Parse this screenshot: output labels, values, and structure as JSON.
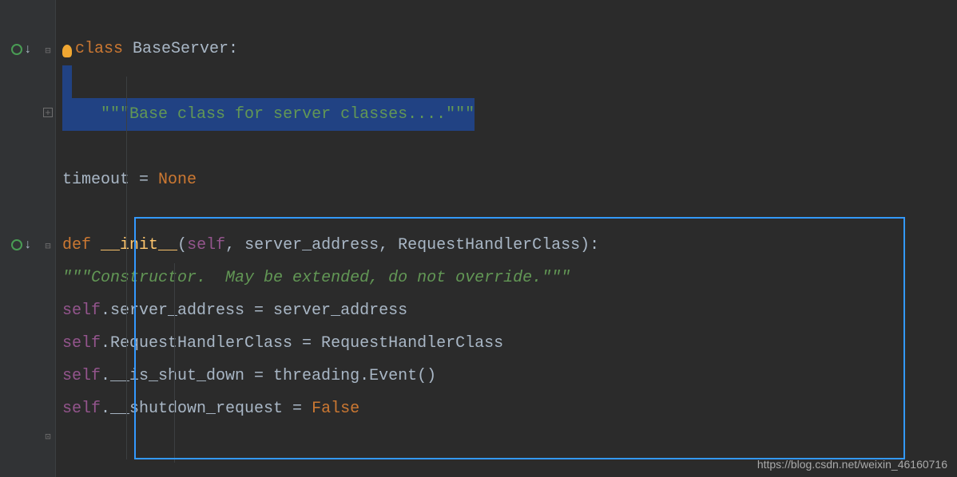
{
  "code": {
    "line1_kw": "class",
    "line1_name": " BaseServer:",
    "docstring1_open": "\"\"\"",
    "docstring1_body": "Base class for server classes....",
    "docstring1_close": "\"\"\"",
    "timeout_name": "timeout",
    "timeout_eq": " = ",
    "timeout_val": "None",
    "def_kw": "def",
    "init_name": " __init__",
    "init_params_open": "(",
    "init_self": "self",
    "init_rest": ", server_address, RequestHandlerClass):",
    "init_doc_open": "\"\"\"",
    "init_doc_body": "Constructor.  May be extended, do not override.",
    "init_doc_close": "\"\"\"",
    "l1_self": "self",
    "l1_rest": ".server_address = server_address",
    "l2_self": "self",
    "l2_rest": ".RequestHandlerClass = RequestHandlerClass",
    "l3_self": "self",
    "l3_rest": ".__is_shut_down = threading.Event()",
    "l4_self": "self",
    "l4_rest1": ".__shutdown_request = ",
    "l4_val": "False"
  },
  "watermark": "https://blog.csdn.net/weixin_46160716"
}
